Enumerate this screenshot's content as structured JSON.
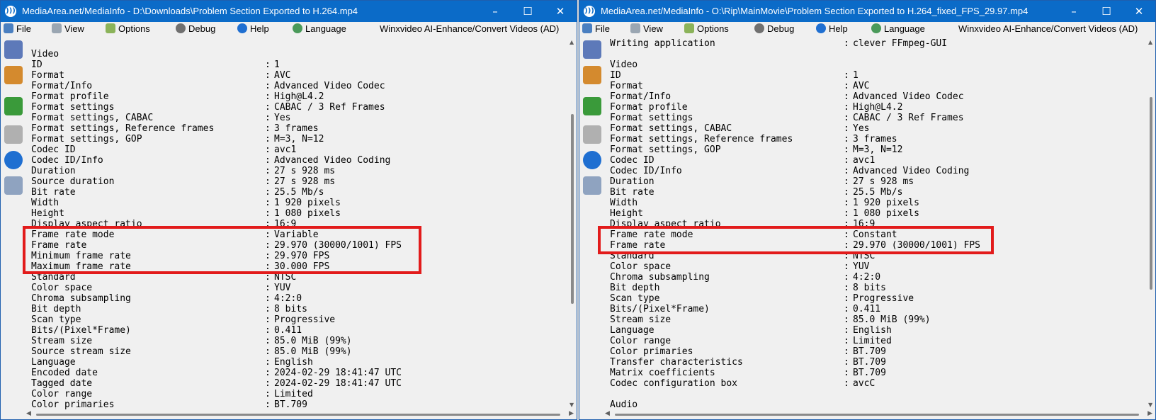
{
  "windows": [
    {
      "title": "MediaArea.net/MediaInfo - D:\\Downloads\\Problem Section Exported to H.264.mp4",
      "menu": [
        "File",
        "View",
        "Options",
        "Debug",
        "Help",
        "Language",
        "Winxvideo AI-Enhance/Convert Videos (AD)"
      ],
      "rows": [
        {
          "k": "Video",
          "v": ""
        },
        {
          "k": "ID",
          "v": "1"
        },
        {
          "k": "Format",
          "v": "AVC"
        },
        {
          "k": "Format/Info",
          "v": "Advanced Video Codec"
        },
        {
          "k": "Format profile",
          "v": "High@L4.2"
        },
        {
          "k": "Format settings",
          "v": "CABAC / 3 Ref Frames"
        },
        {
          "k": "Format settings, CABAC",
          "v": "Yes"
        },
        {
          "k": "Format settings, Reference frames",
          "v": "3 frames"
        },
        {
          "k": "Format settings, GOP",
          "v": "M=3, N=12"
        },
        {
          "k": "Codec ID",
          "v": "avc1"
        },
        {
          "k": "Codec ID/Info",
          "v": "Advanced Video Coding"
        },
        {
          "k": "Duration",
          "v": "27 s 928 ms"
        },
        {
          "k": "Source duration",
          "v": "27 s 928 ms"
        },
        {
          "k": "Bit rate",
          "v": "25.5 Mb/s"
        },
        {
          "k": "Width",
          "v": "1 920 pixels"
        },
        {
          "k": "Height",
          "v": "1 080 pixels"
        },
        {
          "k": "Display aspect ratio",
          "v": "16:9"
        },
        {
          "k": "Frame rate mode",
          "v": "Variable"
        },
        {
          "k": "Frame rate",
          "v": "29.970 (30000/1001) FPS"
        },
        {
          "k": "Minimum frame rate",
          "v": "29.970 FPS"
        },
        {
          "k": "Maximum frame rate",
          "v": "30.000 FPS"
        },
        {
          "k": "Standard",
          "v": "NTSC"
        },
        {
          "k": "Color space",
          "v": "YUV"
        },
        {
          "k": "Chroma subsampling",
          "v": "4:2:0"
        },
        {
          "k": "Bit depth",
          "v": "8 bits"
        },
        {
          "k": "Scan type",
          "v": "Progressive"
        },
        {
          "k": "Bits/(Pixel*Frame)",
          "v": "0.411"
        },
        {
          "k": "Stream size",
          "v": "85.0 MiB (99%)"
        },
        {
          "k": "Source stream size",
          "v": "85.0 MiB (99%)"
        },
        {
          "k": "Language",
          "v": "English"
        },
        {
          "k": "Encoded date",
          "v": "2024-02-29 18:41:47 UTC"
        },
        {
          "k": "Tagged date",
          "v": "2024-02-29 18:41:47 UTC"
        },
        {
          "k": "Color range",
          "v": "Limited"
        },
        {
          "k": "Color primaries",
          "v": "BT.709"
        }
      ]
    },
    {
      "title": "MediaArea.net/MediaInfo - O:\\Rip\\MainMovie\\Problem Section Exported to H.264_fixed_FPS_29.97.mp4",
      "menu": [
        "File",
        "View",
        "Options",
        "Debug",
        "Help",
        "Language",
        "Winxvideo AI-Enhance/Convert Videos (AD)"
      ],
      "rows": [
        {
          "k": "Writing application",
          "v": "clever FFmpeg-GUI"
        },
        {
          "k": "",
          "v": ""
        },
        {
          "k": "Video",
          "v": ""
        },
        {
          "k": "ID",
          "v": "1"
        },
        {
          "k": "Format",
          "v": "AVC"
        },
        {
          "k": "Format/Info",
          "v": "Advanced Video Codec"
        },
        {
          "k": "Format profile",
          "v": "High@L4.2"
        },
        {
          "k": "Format settings",
          "v": "CABAC / 3 Ref Frames"
        },
        {
          "k": "Format settings, CABAC",
          "v": "Yes"
        },
        {
          "k": "Format settings, Reference frames",
          "v": "3 frames"
        },
        {
          "k": "Format settings, GOP",
          "v": "M=3, N=12"
        },
        {
          "k": "Codec ID",
          "v": "avc1"
        },
        {
          "k": "Codec ID/Info",
          "v": "Advanced Video Coding"
        },
        {
          "k": "Duration",
          "v": "27 s 928 ms"
        },
        {
          "k": "Bit rate",
          "v": "25.5 Mb/s"
        },
        {
          "k": "Width",
          "v": "1 920 pixels"
        },
        {
          "k": "Height",
          "v": "1 080 pixels"
        },
        {
          "k": "Display aspect ratio",
          "v": "16:9"
        },
        {
          "k": "Frame rate mode",
          "v": "Constant"
        },
        {
          "k": "Frame rate",
          "v": "29.970 (30000/1001) FPS"
        },
        {
          "k": "Standard",
          "v": "NTSC"
        },
        {
          "k": "Color space",
          "v": "YUV"
        },
        {
          "k": "Chroma subsampling",
          "v": "4:2:0"
        },
        {
          "k": "Bit depth",
          "v": "8 bits"
        },
        {
          "k": "Scan type",
          "v": "Progressive"
        },
        {
          "k": "Bits/(Pixel*Frame)",
          "v": "0.411"
        },
        {
          "k": "Stream size",
          "v": "85.0 MiB (99%)"
        },
        {
          "k": "Language",
          "v": "English"
        },
        {
          "k": "Color range",
          "v": "Limited"
        },
        {
          "k": "Color primaries",
          "v": "BT.709"
        },
        {
          "k": "Transfer characteristics",
          "v": "BT.709"
        },
        {
          "k": "Matrix coefficients",
          "v": "BT.709"
        },
        {
          "k": "Codec configuration box",
          "v": "avcC"
        },
        {
          "k": "",
          "v": ""
        },
        {
          "k": "Audio",
          "v": ""
        }
      ]
    }
  ],
  "colors": {
    "titlebar": "#0b6bc8",
    "highlight": "#e21b1b"
  }
}
